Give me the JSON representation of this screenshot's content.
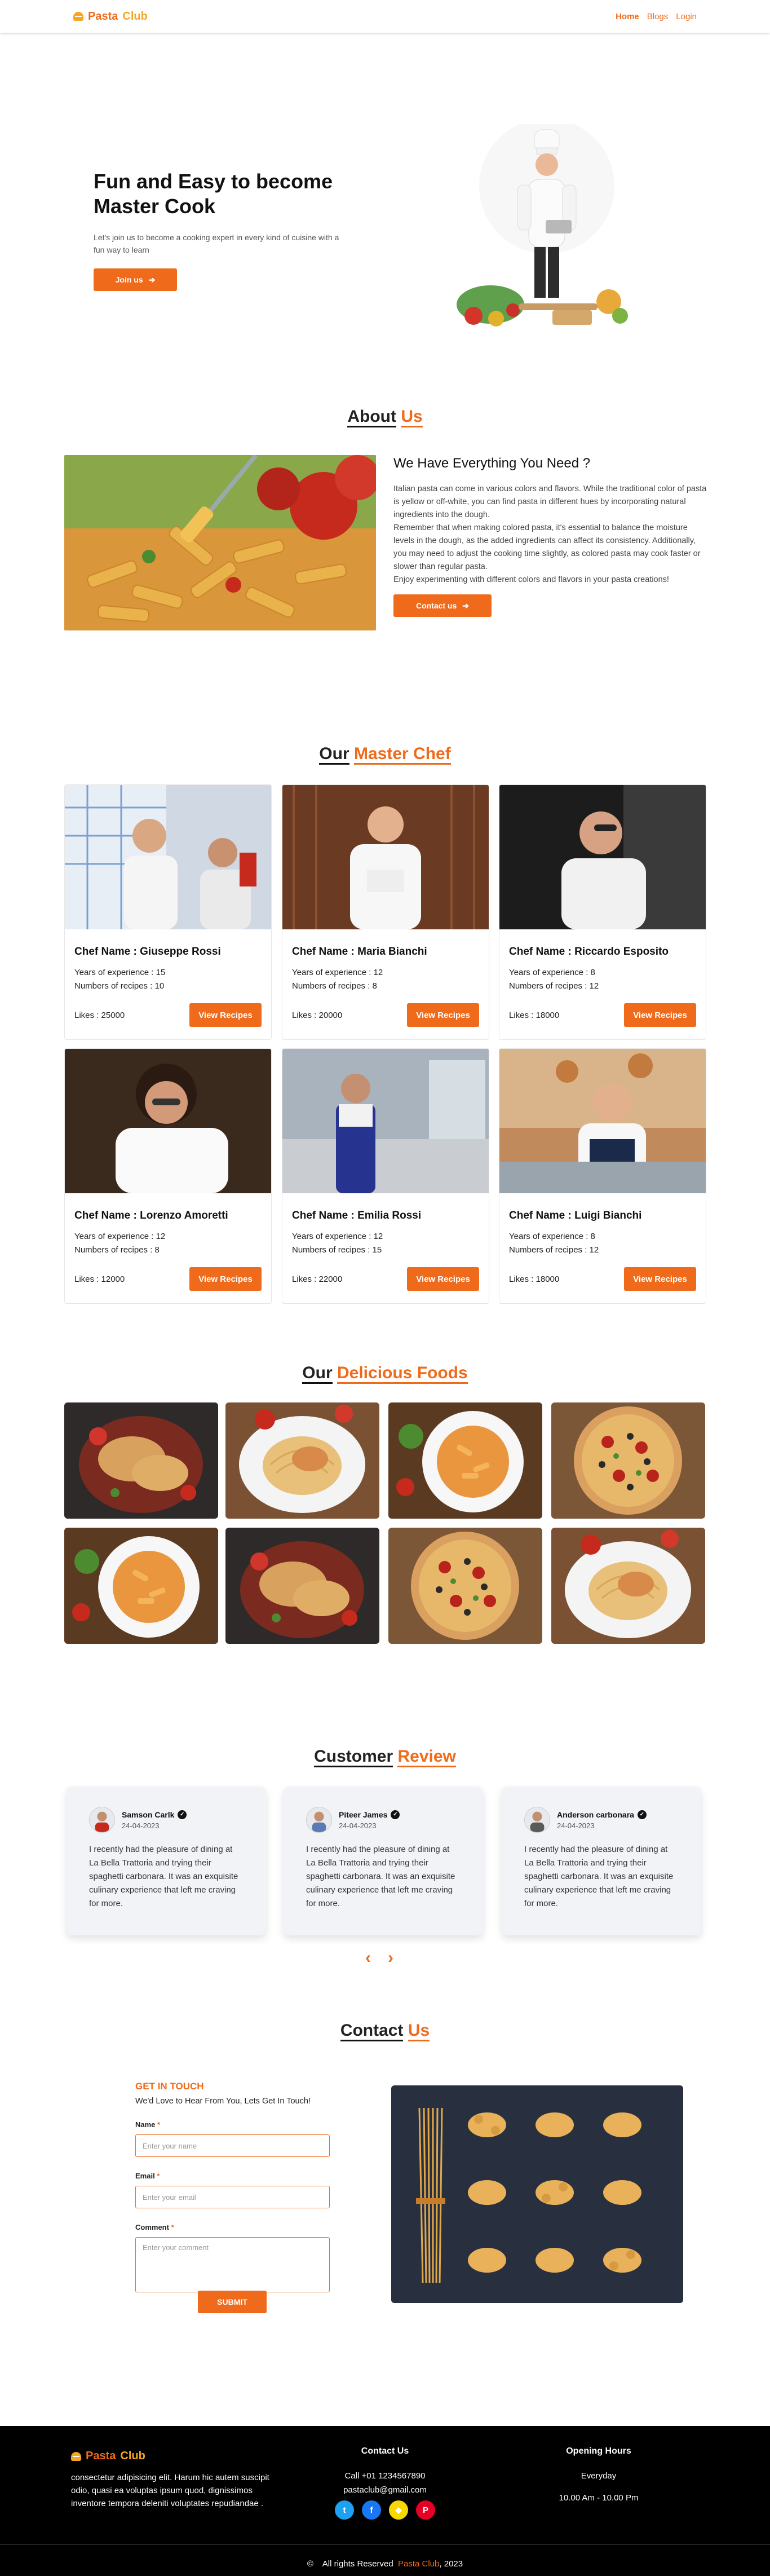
{
  "nav": {
    "brand_1": "Pasta",
    "brand_2": "Club",
    "links": [
      "Home",
      "Blogs",
      "Login"
    ]
  },
  "hero": {
    "title": "Fun and Easy to become Master Cook",
    "subtitle": "Let's join us to become a cooking expert in every kind of cuisine with a fun way to learn",
    "button": "Join us",
    "icon": "arrow-right-icon"
  },
  "about": {
    "title_1": "About",
    "title_2": "Us",
    "heading": "We Have Everything You Need ?",
    "body": [
      "Italian pasta can come in various colors and flavors. While the traditional color of pasta is yellow or off-white, you can find pasta in different hues by incorporating natural ingredients into the dough.",
      "Remember that when making colored pasta, it's essential to balance the moisture levels in the dough, as the added ingredients can affect its consistency. Additionally, you may need to adjust the cooking time slightly, as colored pasta may cook faster or slower than regular pasta.",
      "Enjoy experimenting with different colors and flavors in your pasta creations!"
    ],
    "button": "Contact us"
  },
  "chefs": {
    "title_1": "Our",
    "title_2": "Master Chef",
    "name_prefix": "Chef Name : ",
    "exp_prefix": "Years of experience : ",
    "rec_prefix": "Numbers of recipes : ",
    "likes_prefix": "Likes : ",
    "button": "View Recipes",
    "items": [
      {
        "name": "Giuseppe Rossi",
        "years": "15",
        "recipes": "10",
        "likes": "25000"
      },
      {
        "name": "Maria Bianchi",
        "years": "12",
        "recipes": "8",
        "likes": "20000"
      },
      {
        "name": "Riccardo Esposito",
        "years": "8",
        "recipes": "12",
        "likes": "18000"
      },
      {
        "name": "Lorenzo Amoretti",
        "years": "12",
        "recipes": "8",
        "likes": "12000"
      },
      {
        "name": "Emilia Rossi",
        "years": "12",
        "recipes": "15",
        "likes": "22000"
      },
      {
        "name": "Luigi Bianchi",
        "years": "8",
        "recipes": "12",
        "likes": "18000"
      }
    ]
  },
  "foods": {
    "title_1": "Our",
    "title_2": "Delicious Foods"
  },
  "reviews": {
    "title_1": "Customer",
    "title_2": "Review",
    "items": [
      {
        "name": "Samson Carlk",
        "date": "24-04-2023",
        "text": "I recently had the pleasure of dining at La Bella Trattoria and trying their spaghetti carbonara. It was an exquisite culinary experience that left me craving for more."
      },
      {
        "name": "Piteer James",
        "date": "24-04-2023",
        "text": "I recently had the pleasure of dining at La Bella Trattoria and trying their spaghetti carbonara. It was an exquisite culinary experience that left me craving for more."
      },
      {
        "name": "Anderson carbonara",
        "date": "24-04-2023",
        "text": "I recently had the pleasure of dining at La Bella Trattoria and trying their spaghetti carbonara. It was an exquisite culinary experience that left me craving for more."
      }
    ],
    "prev": "‹",
    "next": "›"
  },
  "contact": {
    "title_1": "Contact",
    "title_2": "Us",
    "heading": "GET IN TOUCH",
    "sub": "We'd Love to Hear From You, Lets Get In Touch!",
    "name_label": "Name",
    "name_placeholder": "Enter your name",
    "email_label": "Email",
    "email_placeholder": "Enter your email",
    "comment_label": "Comment",
    "comment_placeholder": "Enter your comment",
    "required": "*",
    "submit": "SUBMIT"
  },
  "footer": {
    "brand_1": "Pasta",
    "brand_2": "Club",
    "desc": "consectetur adipisicing elit. Harum hic autem suscipit odio, quasi ea voluptas ipsum quod, dignissimos inventore tempora deleniti voluptates repudiandae .",
    "contact_title": "Contact Us",
    "phone": "Call +01 1234567890",
    "email": "pastaclub@gmail.com",
    "hours_title": "Opening Hours",
    "hours_days": "Everyday",
    "hours_time": "10.00 Am - 10.00 Pm",
    "copy_symbol": "©",
    "copy_1": "All rights Reserved",
    "copy_brand": "Pasta  Club",
    "copy_2": ", 2023",
    "socials": [
      "twitter-icon",
      "facebook-icon",
      "snapchat-icon",
      "pinterest-icon"
    ]
  },
  "colors": {
    "accent": "#f06a1b",
    "brand_yellow": "#f5a623",
    "footer_bg": "#000000"
  }
}
